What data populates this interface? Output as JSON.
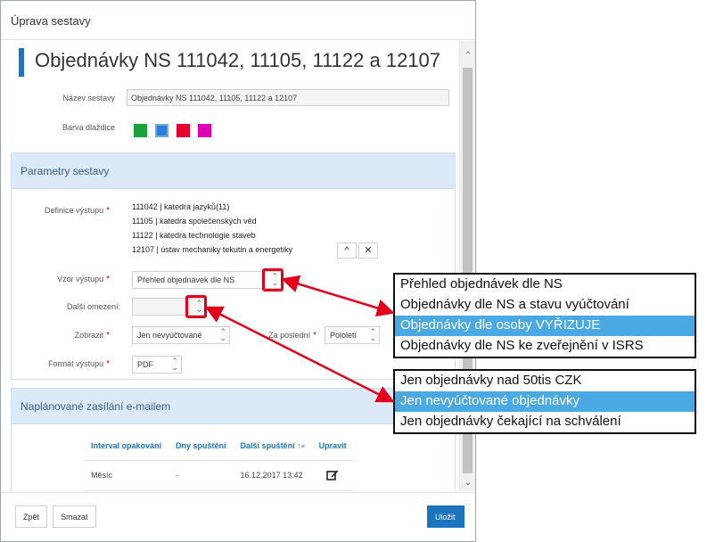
{
  "dialog": {
    "title": "Úprava sestavy",
    "main_title": "Objednávky NS 111042, 11105, 11122 a 12107"
  },
  "form": {
    "name_label": "Název sestavy",
    "name_value": "Objednávky NS 111042, 11105, 11122 a 12107",
    "color_label": "Barva dlaždice",
    "swatches": [
      "#1aa23a",
      "#2b7fd4",
      "#e8002c",
      "#e000b4"
    ]
  },
  "params": {
    "header": "Parametry sestavy",
    "definition_label": "Definice výstupu",
    "definition_lines": [
      "111042 | katedra jazyků(11)",
      "11105 | katedra společenských věd",
      "11122 | katedra technologie staveb",
      "12107 | ústav mechaniky tekutin a energetiky"
    ],
    "btn_up": "^",
    "btn_close": "✕",
    "template_label": "Vzor výstupu",
    "template_value": "Přehled objednávek dle NS",
    "extra_label": "Další omezení:",
    "extra_value": "",
    "show_label": "Zobrazit",
    "show_value": "Jen nevyúčtované",
    "last_label": "Za poslední",
    "last_value": "Pololetí",
    "format_label": "Formát výstupu",
    "format_value": "PDF"
  },
  "schedule": {
    "header": "Naplánované zasílání e-mailem",
    "columns": [
      "Interval opakování",
      "Dny spuštění",
      "Další spuštění ↑",
      "Upravit"
    ],
    "rows": [
      {
        "interval": "Měsíc",
        "days": "-",
        "next": "16.12.2017 13:42"
      }
    ]
  },
  "footer": {
    "back": "Zpět",
    "delete": "Smazat",
    "save": "Uložit"
  },
  "callout_template": {
    "options": [
      "Přehled objednávek dle NS",
      "Objednávky dle NS a stavu vyúčtování",
      "Objednávky dle osoby VYŘIZUJE",
      "Objednávky dle NS ke zveřejnění v ISRS"
    ],
    "active_index": 2
  },
  "callout_extra": {
    "options": [
      "Jen objednávky nad 50tis CZK",
      "Jen nevyúčtované objednávky",
      "Jen objednávky čekající na schválení"
    ],
    "active_index": 1
  },
  "colors": {
    "accent": "#1e73be",
    "highlight": "#e3001b",
    "active_option": "#4aa8e3"
  }
}
